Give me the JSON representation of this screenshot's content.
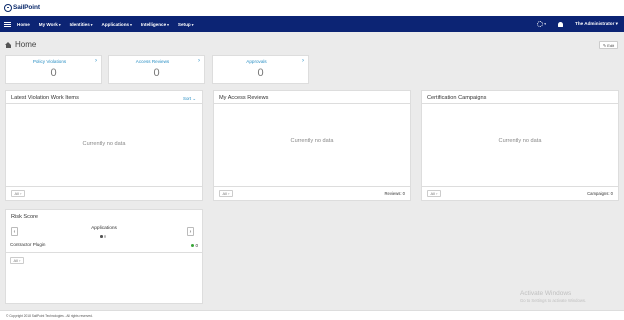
{
  "brand": {
    "logo_text": "SailPoint"
  },
  "nav": {
    "items": [
      {
        "label": "Home",
        "has_caret": false
      },
      {
        "label": "My Work",
        "has_caret": true
      },
      {
        "label": "Identities",
        "has_caret": true
      },
      {
        "label": "Applications",
        "has_caret": true
      },
      {
        "label": "Intelligence",
        "has_caret": true
      },
      {
        "label": "Setup",
        "has_caret": true
      }
    ],
    "caret": "▾",
    "user": "The Administrator ▾",
    "gear_caret": "▾"
  },
  "page": {
    "title": "Home",
    "edit_label": "Edit"
  },
  "stats": [
    {
      "label": "Policy Violations",
      "value": "0"
    },
    {
      "label": "Access Reviews",
      "value": "0"
    },
    {
      "label": "Approvals",
      "value": "0"
    }
  ],
  "chevron": "›",
  "panels": {
    "violations": {
      "title": "Latest Violation Work Items",
      "sort_label": "Sort ⌄",
      "empty": "Currently no data",
      "all_label": "All ›"
    },
    "access_reviews": {
      "title": "My Access Reviews",
      "empty": "Currently no data",
      "all_label": "All ›",
      "count_label": "Reviews: 0"
    },
    "campaigns": {
      "title": "Certification Campaigns",
      "empty": "Currently no data",
      "all_label": "All ›",
      "count_label": "Campaigns: 0"
    },
    "risk": {
      "title": "Risk Score",
      "category": "Applications",
      "prev": "‹",
      "next": "›",
      "row_label": "Contractor Plugin",
      "row_score": "0",
      "all_label": "All ›"
    }
  },
  "footer": {
    "copyright": "© Copyright 2018 SailPoint Technologies - All rights reserved."
  },
  "watermark": {
    "line1": "Activate Windows",
    "line2": "Go to Settings to activate Windows."
  },
  "colors": {
    "navbar": "#0c2474",
    "accent_link": "#2a8fc4",
    "score_dot": "#3aa63a"
  }
}
